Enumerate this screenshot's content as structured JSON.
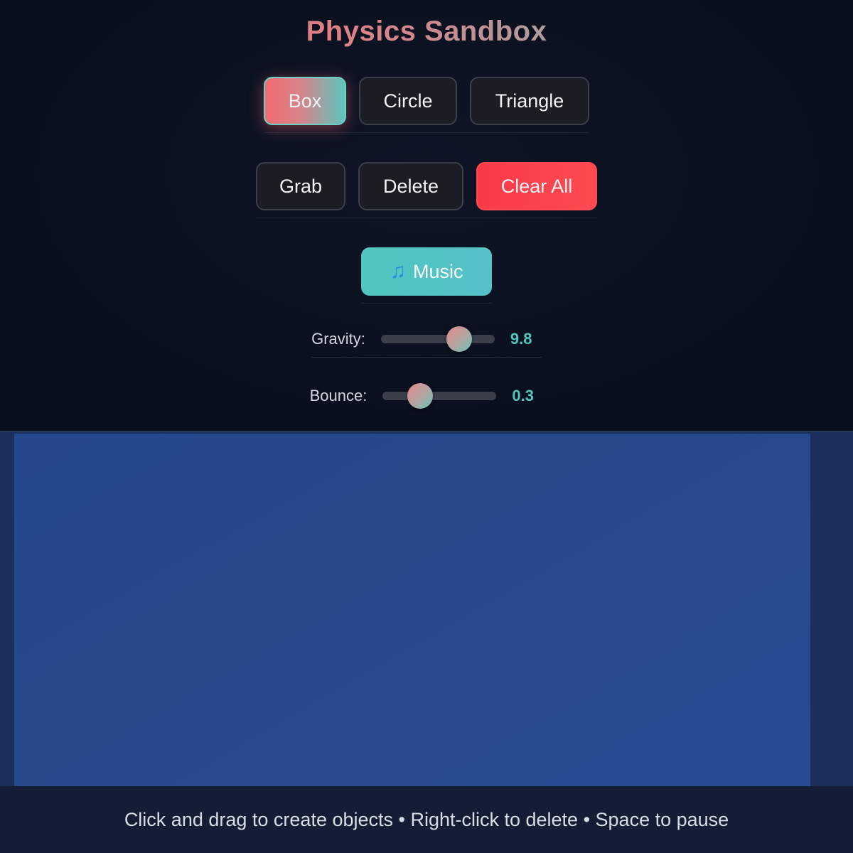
{
  "app": {
    "title": "Physics Sandbox"
  },
  "shapes": {
    "items": [
      {
        "label": "Box",
        "active": true
      },
      {
        "label": "Circle",
        "active": false
      },
      {
        "label": "Triangle",
        "active": false
      }
    ]
  },
  "tools": {
    "grab_label": "Grab",
    "delete_label": "Delete",
    "clear_label": "Clear All"
  },
  "music": {
    "icon": "musical-note-icon",
    "icon_glyph": "♫",
    "label": "Music"
  },
  "sliders": {
    "gravity": {
      "label": "Gravity:",
      "value": "9.8",
      "fraction": 0.69
    },
    "bounce": {
      "label": "Bounce:",
      "value": "0.3",
      "fraction": 0.33
    }
  },
  "footer": {
    "hint": "Click and drag to create objects • Right-click to delete • Space to pause"
  },
  "colors": {
    "accent_coral": "#f06b70",
    "accent_teal": "#4fc7be",
    "danger": "#ff4a52",
    "canvas_blue": "#26498c",
    "background": "#0a0f1c"
  }
}
